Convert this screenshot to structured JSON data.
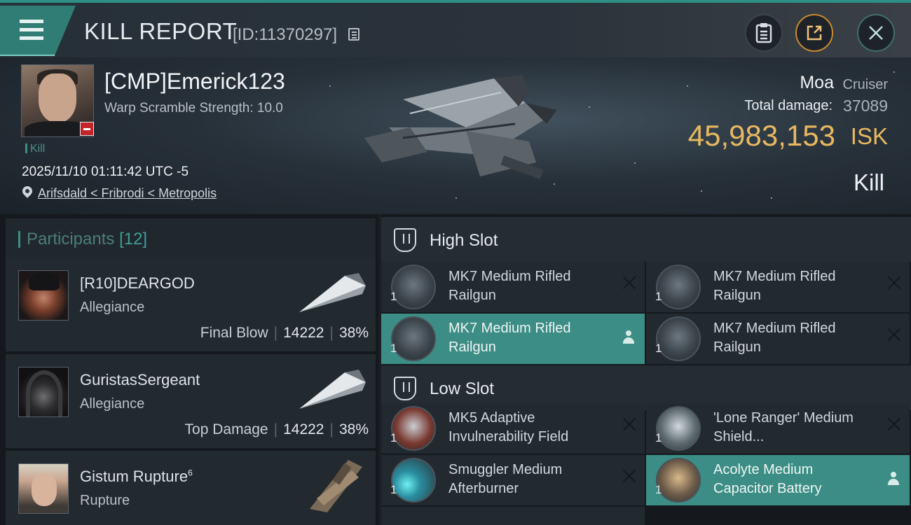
{
  "header": {
    "title": "KILL REPORT",
    "id_text": "[ID:11370297]"
  },
  "victim": {
    "name": "[CMP]Emerick123",
    "subtitle": "Warp Scramble Strength: 10.0",
    "tag": "Kill",
    "timestamp": "2025/11/10 01:11:42 UTC -5",
    "location": "Arifsdald < Fribrodi < Metropolis",
    "ship_name": "Moa",
    "ship_class": "Cruiser",
    "damage_label": "Total damage:",
    "damage_value": "37089",
    "isk_value": "45,983,153",
    "isk_unit": "ISK",
    "result": "Kill"
  },
  "participants": {
    "label": "Participants",
    "count": "[12]",
    "rows": [
      {
        "name": "[R10]DEARGOD",
        "corp": "Allegiance",
        "role": "Final Blow",
        "damage": "14222",
        "percent": "38%"
      },
      {
        "name": "GuristasSergeant",
        "corp": "Allegiance",
        "role": "Top Damage",
        "damage": "14222",
        "percent": "38%"
      },
      {
        "name": "Gistum Rupture",
        "name_sup": "6",
        "corp": "Rupture"
      }
    ]
  },
  "modules": {
    "high_slot_label": "High Slot",
    "low_slot_label": "Low Slot",
    "high": [
      {
        "name": "MK7 Medium Rifled Railgun",
        "qty": "1"
      },
      {
        "name": "MK7 Medium Rifled Railgun",
        "qty": "1"
      },
      {
        "name": "MK7 Medium Rifled Railgun",
        "qty": "1"
      },
      {
        "name": "MK7 Medium Rifled Railgun",
        "qty": "1"
      }
    ],
    "low": [
      {
        "name": "MK5 Adaptive Invulnerability Field",
        "qty": "1"
      },
      {
        "name": "'Lone Ranger' Medium Shield...",
        "qty": "1"
      },
      {
        "name": "Smuggler Medium Afterburner",
        "qty": "1"
      },
      {
        "name": "Acolyte Medium Capacitor Battery",
        "qty": "1"
      }
    ]
  },
  "colors": {
    "accent": "#3c8d85",
    "isk": "#e8b860",
    "victim_badge": "#c4232a"
  }
}
